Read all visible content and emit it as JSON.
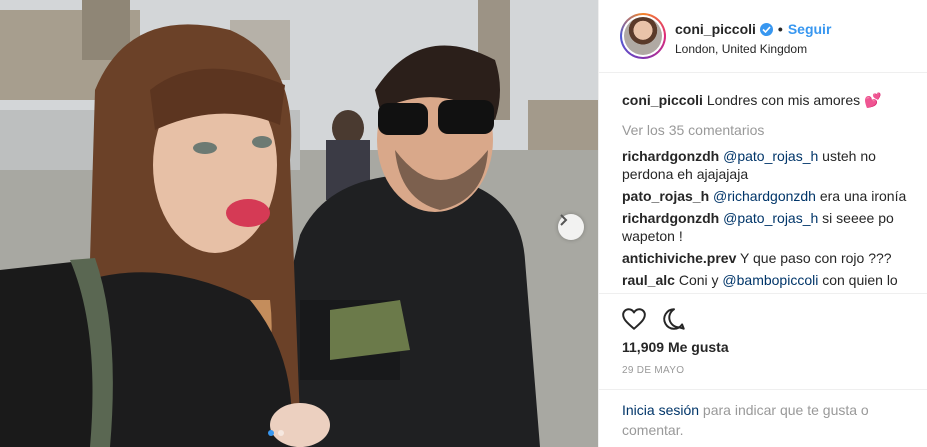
{
  "post": {
    "dots_total": 2,
    "active_dot": 0
  },
  "header": {
    "username": "coni_piccoli",
    "separator": "•",
    "follow_label": "Seguir",
    "location": "London, United Kingdom"
  },
  "caption": {
    "username": "coni_piccoli",
    "text": "Londres con mis amores",
    "emoji": "💕"
  },
  "view_all_comments": "Ver los 35 comentarios",
  "comments": [
    {
      "username": "richardgonzdh",
      "mention": "@pato_rojas_h",
      "text": " usteh no perdona eh ajajajaja"
    },
    {
      "username": "pato_rojas_h",
      "mention": "@richardgonzdh",
      "text": " era una ironía"
    },
    {
      "username": "richardgonzdh",
      "mention": "@pato_rojas_h",
      "text": " si seeee po wapeton !"
    },
    {
      "username": "antichiviche.prev",
      "mention": "",
      "text": "Y que paso con rojo ???"
    },
    {
      "username": "raul_alc",
      "prefix": "Coni y ",
      "mention": "@bambopiccoli",
      "text": " con quien lo"
    }
  ],
  "likes": "11,909 Me gusta",
  "date": "29 DE MAYO",
  "login": {
    "link": "Inicia sesión",
    "text": " para indicar que te gusta o comentar."
  },
  "colors": {
    "link_blue": "#3897f0",
    "mention_navy": "#003569",
    "muted_gray": "#999999"
  },
  "icons": [
    "verified-icon",
    "heart-icon",
    "comment-icon",
    "chevron-right-icon"
  ]
}
